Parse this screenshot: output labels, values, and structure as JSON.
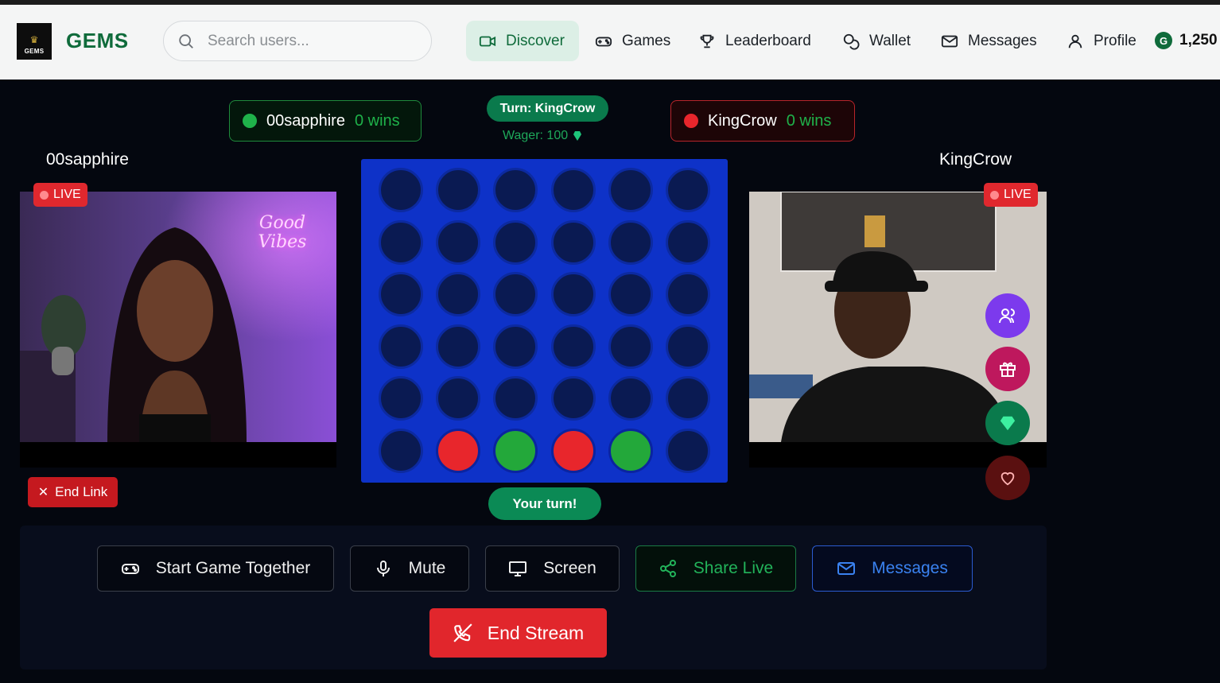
{
  "nav": {
    "logo_text": "GEMS",
    "brand": "GEMS",
    "search_placeholder": "Search users...",
    "items": [
      {
        "label": "Discover",
        "icon": "video-camera-icon",
        "active": true
      },
      {
        "label": "Games",
        "icon": "gamepad-icon"
      },
      {
        "label": "Leaderboard",
        "icon": "trophy-icon"
      },
      {
        "label": "Wallet",
        "icon": "coins-icon"
      },
      {
        "label": "Messages",
        "icon": "mail-icon"
      },
      {
        "label": "Profile",
        "icon": "user-icon"
      }
    ],
    "balance": "1,250",
    "coin_symbol": "G"
  },
  "game": {
    "player1": {
      "name": "00sapphire",
      "wins": "0 wins",
      "color": "#1fb24a"
    },
    "player2": {
      "name": "KingCrow",
      "wins": "0 wins",
      "color": "#e8262c"
    },
    "turn": "Turn: KingCrow",
    "wager": "Wager: 100",
    "status": "Your turn!",
    "board_rows": 6,
    "board_cols": 6,
    "pieces": [
      {
        "row": 5,
        "col": 1,
        "color": "red"
      },
      {
        "row": 5,
        "col": 2,
        "color": "green"
      },
      {
        "row": 5,
        "col": 3,
        "color": "red"
      },
      {
        "row": 5,
        "col": 4,
        "color": "green"
      }
    ]
  },
  "streams": {
    "left": {
      "name": "00sapphire",
      "live": "LIVE",
      "neon_sign": "Good Vibes"
    },
    "right": {
      "name": "KingCrow",
      "live": "LIVE"
    }
  },
  "end_link": "End Link",
  "side_actions": [
    {
      "icon": "users-icon",
      "color": "#7c3aed"
    },
    {
      "icon": "gift-icon",
      "color": "#be185d"
    },
    {
      "icon": "gem-icon",
      "color": "#0a7a4c"
    },
    {
      "icon": "heart-icon",
      "color": "#5a1010"
    }
  ],
  "controls": {
    "start_game": "Start Game Together",
    "mute": "Mute",
    "screen": "Screen",
    "share_live": "Share Live",
    "messages": "Messages",
    "end_stream": "End Stream"
  }
}
